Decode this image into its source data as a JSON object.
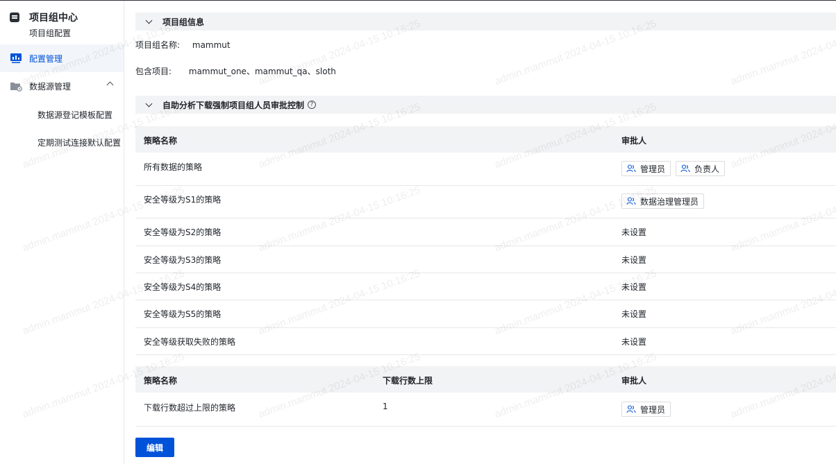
{
  "sidebar": {
    "brand_title": "项目组中心",
    "brand_subtitle": "项目组配置",
    "items": [
      {
        "label": "配置管理",
        "icon": "monitor-chart-icon",
        "active": true
      },
      {
        "label": "数据源管理",
        "icon": "folder-gear-icon",
        "expanded": true
      }
    ],
    "sub_items": [
      {
        "label": "数据源登记模板配置"
      },
      {
        "label": "定期测试连接默认配置"
      }
    ]
  },
  "project_info": {
    "section_title": "项目组信息",
    "name_label": "项目组名称:",
    "name_value": "mammut",
    "projects_label": "包含项目:",
    "projects_value": "mammut_one、mammut_qa、sloth"
  },
  "approval": {
    "section_title": "自助分析下载强制项目组人员审批控制",
    "help_glyph": "?",
    "table1": {
      "headers": {
        "policy": "策略名称",
        "approver": "审批人"
      },
      "rows": [
        {
          "policy": "所有数据的策略",
          "tags": [
            "管理员",
            "负责人"
          ]
        },
        {
          "policy": "安全等级为S1的策略",
          "tags": [
            "数据治理管理员"
          ]
        },
        {
          "policy": "安全等级为S2的策略",
          "approver_text": "未设置"
        },
        {
          "policy": "安全等级为S3的策略",
          "approver_text": "未设置"
        },
        {
          "policy": "安全等级为S4的策略",
          "approver_text": "未设置"
        },
        {
          "policy": "安全等级为S5的策略",
          "approver_text": "未设置"
        },
        {
          "policy": "安全等级获取失败的策略",
          "approver_text": "未设置"
        }
      ]
    },
    "table2": {
      "headers": {
        "policy": "策略名称",
        "limit": "下载行数上限",
        "approver": "审批人"
      },
      "rows": [
        {
          "policy": "下载行数超过上限的策略",
          "limit": "1",
          "tags": [
            "管理员"
          ]
        }
      ]
    }
  },
  "actions": {
    "edit_label": "编辑"
  },
  "watermark": {
    "text": "admin.mammut 2024-04-15 10:16:25"
  },
  "colors": {
    "accent": "#0052d9",
    "header_bg": "#f2f3f5",
    "active_nav_bg": "#f2f5f9"
  }
}
